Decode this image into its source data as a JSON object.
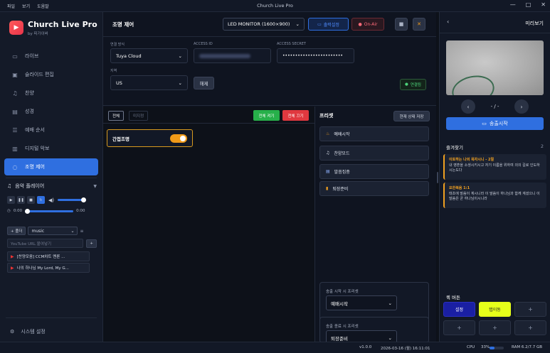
{
  "titlebar": {
    "menus": [
      "파일",
      "보기",
      "도움말"
    ],
    "title": "Church Live Pro",
    "min": "—",
    "max": "□",
    "close": "✕"
  },
  "sidebar": {
    "app_name": "Church Live Pro",
    "app_sub": "by 피가이버",
    "items": [
      {
        "label": "라이브",
        "icon": "video-icon"
      },
      {
        "label": "슬라이드 편집",
        "icon": "monitor-icon"
      },
      {
        "label": "찬양",
        "icon": "music-icon"
      },
      {
        "label": "성경",
        "icon": "book-icon"
      },
      {
        "label": "예배 순서",
        "icon": "list-icon"
      },
      {
        "label": "디지털 악보",
        "icon": "score-icon"
      },
      {
        "label": "조명 제어",
        "icon": "bulb-icon"
      }
    ],
    "music": {
      "title": "음악 플레이어",
      "time_start": "0:00",
      "time_end": "0:00",
      "folder_btn": "+ 폴더",
      "folder": "music",
      "url_placeholder": "YouTube URL 붙여넣기",
      "add": "+",
      "tracks": [
        "[찬양모음] CCM차트 멘론 ...",
        "나의 하나님 My Lord, My G..."
      ]
    },
    "settings": "시스템 설정"
  },
  "main": {
    "page_title": "조명 제어",
    "monitor": "LED MONITOR (1600×900)",
    "output": "출력설정",
    "onair": "On-Air",
    "conn": {
      "method_label": "연결 방식",
      "method": "Tuya Cloud",
      "access_id_label": "ACCESS ID",
      "access_secret_label": "ACCESS SECRET",
      "access_secret": "••••••••••••••••••••••••",
      "region_label": "지역",
      "region": "US",
      "disconnect": "해제",
      "status": "연결됨"
    },
    "lights": {
      "tab_all": "전체",
      "tab_unassigned": "미지정",
      "all_on": "전체 켜기",
      "all_off": "전체 끄기",
      "card": "간접조명",
      "card_on": true
    },
    "presets": {
      "title": "프리셋",
      "save": "현재 상태 저장",
      "items": [
        "예배시작",
        "찬양모드",
        "말씀집중",
        "퇴장준비"
      ],
      "start_label": "송출 시작 시 프리셋",
      "start_value": "예배시작",
      "end_label": "송출 종료 시 프리셋",
      "end_value": "퇴장준비"
    }
  },
  "right": {
    "title": "미리보기",
    "pager": "- / -",
    "send": "송출시작",
    "fav_title": "즐겨찾기",
    "fav_count": "2",
    "favs": [
      {
        "title": "이토하는 나의 목자시니 - 2절",
        "text": "내 영혼을 소생시키시고 자기 이름을 위하여 의의 길로 인도하시는도다"
      },
      {
        "title": "요한복음 1:1",
        "text": "태초에 말씀이 계시니라 이 말씀이 하나님과 함께 계셨으니 이 말씀은 곧 하나님이시니라"
      }
    ],
    "quick_title": "퀵 버튼",
    "quick": [
      "설정",
      "탭이동",
      "+",
      "+",
      "+",
      "+"
    ]
  },
  "status": {
    "version": "v1.0.0",
    "datetime": "2026-03-16 (월) 16:11:01",
    "cpu_label": "CPU",
    "cpu": "33%",
    "cpu_fraction": 0.33,
    "ram": "RAM 6.2/7.7 GB"
  },
  "colors": {
    "accent": "#2f6fe0",
    "danger": "#e0383f",
    "success": "#27b04a",
    "warning": "#f09a18"
  }
}
